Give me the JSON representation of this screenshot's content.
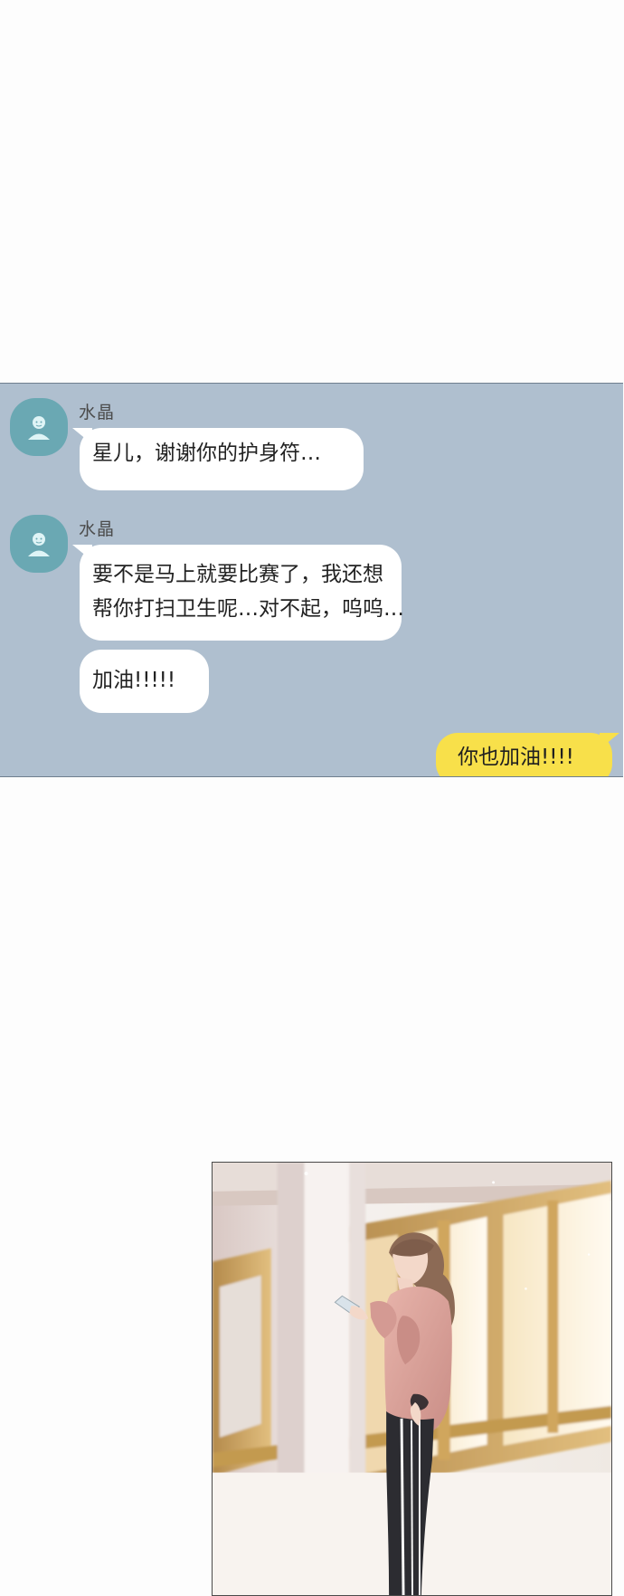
{
  "chat": {
    "messages": [
      {
        "sender": "水晶",
        "avatar_icon": "person-icon",
        "lines": [
          "星儿，谢谢你的护身符…"
        ]
      },
      {
        "sender": "水晶",
        "avatar_icon": "person-icon",
        "lines": [
          "要不是马上就要比赛了，我还想",
          "帮你打扫卫生呢…对不起，呜呜…"
        ]
      },
      {
        "lines": [
          "加油!!!!!"
        ]
      }
    ],
    "reply": {
      "text": "你也加油!!!!"
    }
  },
  "colors": {
    "page_background": "#fdfdfd",
    "chat_background": "#afbfcf",
    "avatar": "#6aa8b3",
    "incoming_bubble": "#ffffff",
    "outgoing_bubble": "#f8e04a",
    "jacket": "#d9a19a",
    "window_frame": "#c39a50"
  }
}
